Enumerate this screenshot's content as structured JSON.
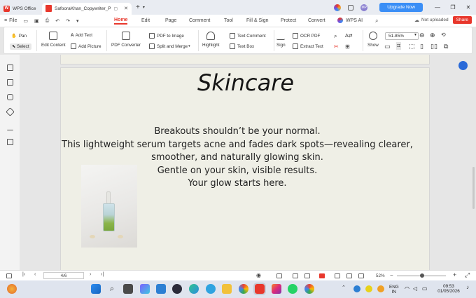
{
  "titlebar": {
    "app_tab": "WPS Office",
    "doc_tab": "SafooraKhan_Copywriter_P",
    "upgrade": "Upgrade Now",
    "user_initials": "MP"
  },
  "menubar": {
    "file": "File",
    "tabs": [
      "Home",
      "Edit",
      "Page",
      "Comment",
      "Tool",
      "Fill & Sign",
      "Protect",
      "Convert",
      "WPS AI"
    ],
    "active_tab": "Home",
    "not_uploaded": "Not uploaded",
    "share": "Share"
  },
  "ribbon": {
    "pan": "Pan",
    "select": "Select",
    "edit_content": "Edit Content",
    "add_text": "Add Text",
    "add_picture": "Add Picture",
    "pdf_to_image": "PDF to Image",
    "pdf_converter": "PDF Converter",
    "split_merge": "Split and Merge",
    "highlight": "Highlight",
    "text_comment": "Text Comment",
    "text_box": "Text Box",
    "sign": "Sign",
    "ocr_pdf": "OCR PDF",
    "extract_text": "Extract Text",
    "show": "Show",
    "zoom": "51.85%"
  },
  "document": {
    "title": "Skincare",
    "body_lines": [
      "Breakouts shouldn’t be your normal.",
      "This lightweight serum targets acne and fades dark spots—revealing clearer,",
      "smoother, and naturally glowing skin.",
      "Gentle on your skin, visible results.",
      "Your glow starts here."
    ]
  },
  "statusbar": {
    "page": "4/6",
    "zoom": "52%",
    "zoom_slider_fraction": 0.52
  },
  "taskbar": {
    "lang_top": "ENG",
    "lang_bottom": "IN",
    "time": "09:53",
    "date": "01/05/2026"
  },
  "colors": {
    "accent": "#e8372c",
    "upgrade": "#3a8ef6",
    "page_bg": "#efefe6"
  }
}
